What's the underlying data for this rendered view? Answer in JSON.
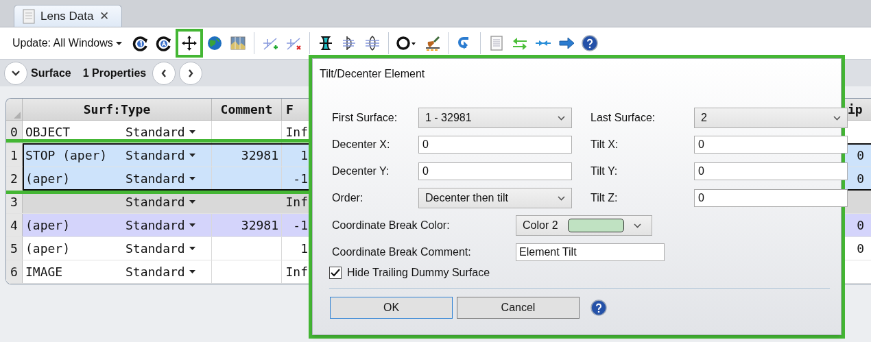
{
  "tab": {
    "label": "Lens Data",
    "close": "✕"
  },
  "toolbar": {
    "update_label": "Update: All Windows",
    "tools": [
      {
        "kind": "refresh-one"
      },
      {
        "kind": "refresh-all"
      },
      {
        "kind": "move",
        "highlighted": true
      },
      {
        "kind": "globe"
      },
      {
        "kind": "map"
      },
      {
        "kind": "separator"
      },
      {
        "kind": "line-add"
      },
      {
        "kind": "line-remove"
      },
      {
        "kind": "separator"
      },
      {
        "kind": "lens-solid"
      },
      {
        "kind": "lens-half"
      },
      {
        "kind": "lens-outline"
      },
      {
        "kind": "separator"
      },
      {
        "kind": "ring-menu"
      },
      {
        "kind": "brush"
      },
      {
        "kind": "separator"
      },
      {
        "kind": "undo"
      },
      {
        "kind": "separator"
      },
      {
        "kind": "document"
      },
      {
        "kind": "swap"
      },
      {
        "kind": "converge"
      },
      {
        "kind": "arrow"
      },
      {
        "kind": "help"
      }
    ]
  },
  "surface_bar": {
    "section": "Surface",
    "properties": "1 Properties"
  },
  "table": {
    "columns": [
      "Surf:Type",
      "Comment",
      "F",
      "ip"
    ],
    "rows": [
      {
        "number": "0",
        "surface": "OBJECT",
        "type": "Standard",
        "comment": "",
        "column_3": "Inf",
        "column_4": "",
        "selected": false
      },
      {
        "number": "1",
        "surface": "STOP (aper)",
        "type": "Standard",
        "comment": "32981",
        "column_3": "1",
        "column_4": "0",
        "selected": true,
        "highlighted": true
      },
      {
        "number": "2",
        "surface": "(aper)",
        "type": "Standard",
        "comment": "",
        "column_3": "-1",
        "column_4": "0",
        "selected": true,
        "highlighted": true
      },
      {
        "number": "3",
        "surface": "",
        "type": "Standard",
        "comment": "",
        "column_3": "Inf",
        "column_4": "",
        "selected": false,
        "color": "#d9d9d9"
      },
      {
        "number": "4",
        "surface": "(aper)",
        "type": "Standard",
        "comment": "32981",
        "column_3": "-1",
        "column_4": "0",
        "selected": false,
        "color": "#d4d4fb"
      },
      {
        "number": "5",
        "surface": "(aper)",
        "type": "Standard",
        "comment": "",
        "column_3": "1",
        "column_4": "0",
        "selected": false
      },
      {
        "number": "6",
        "surface": "IMAGE",
        "type": "Standard",
        "comment": "",
        "column_3": "Inf",
        "column_4": "",
        "selected": false
      }
    ]
  },
  "dialog": {
    "title": "Tilt/Decenter Element",
    "highlighted": true,
    "fields": [
      {
        "label": "First Surface:",
        "kind": "dropdown",
        "value": "1 - 32981"
      },
      {
        "label": "Last Surface:",
        "kind": "dropdown",
        "value": "2"
      },
      {
        "label": "Decenter X:",
        "kind": "text",
        "value": "0"
      },
      {
        "label": "Tilt X:",
        "kind": "text",
        "value": "0"
      },
      {
        "label": "Decenter Y:",
        "kind": "text",
        "value": "0"
      },
      {
        "label": "Tilt Y:",
        "kind": "text",
        "value": "0"
      },
      {
        "label": "Order:",
        "kind": "dropdown",
        "value": "Decenter then tilt"
      },
      {
        "label": "Tilt Z:",
        "kind": "text",
        "value": "0"
      }
    ],
    "color_field": {
      "label": "Coordinate Break Color:",
      "value": "Color 2",
      "color": "#c0e2c2"
    },
    "comment_field": {
      "label": "Coordinate Break Comment:",
      "value": "Element Tilt"
    },
    "checkbox": {
      "label": "Hide Trailing Dummy Surface",
      "checked": true
    },
    "buttons": [
      {
        "label": "OK",
        "default": true
      },
      {
        "label": "Cancel",
        "default": false
      }
    ]
  }
}
